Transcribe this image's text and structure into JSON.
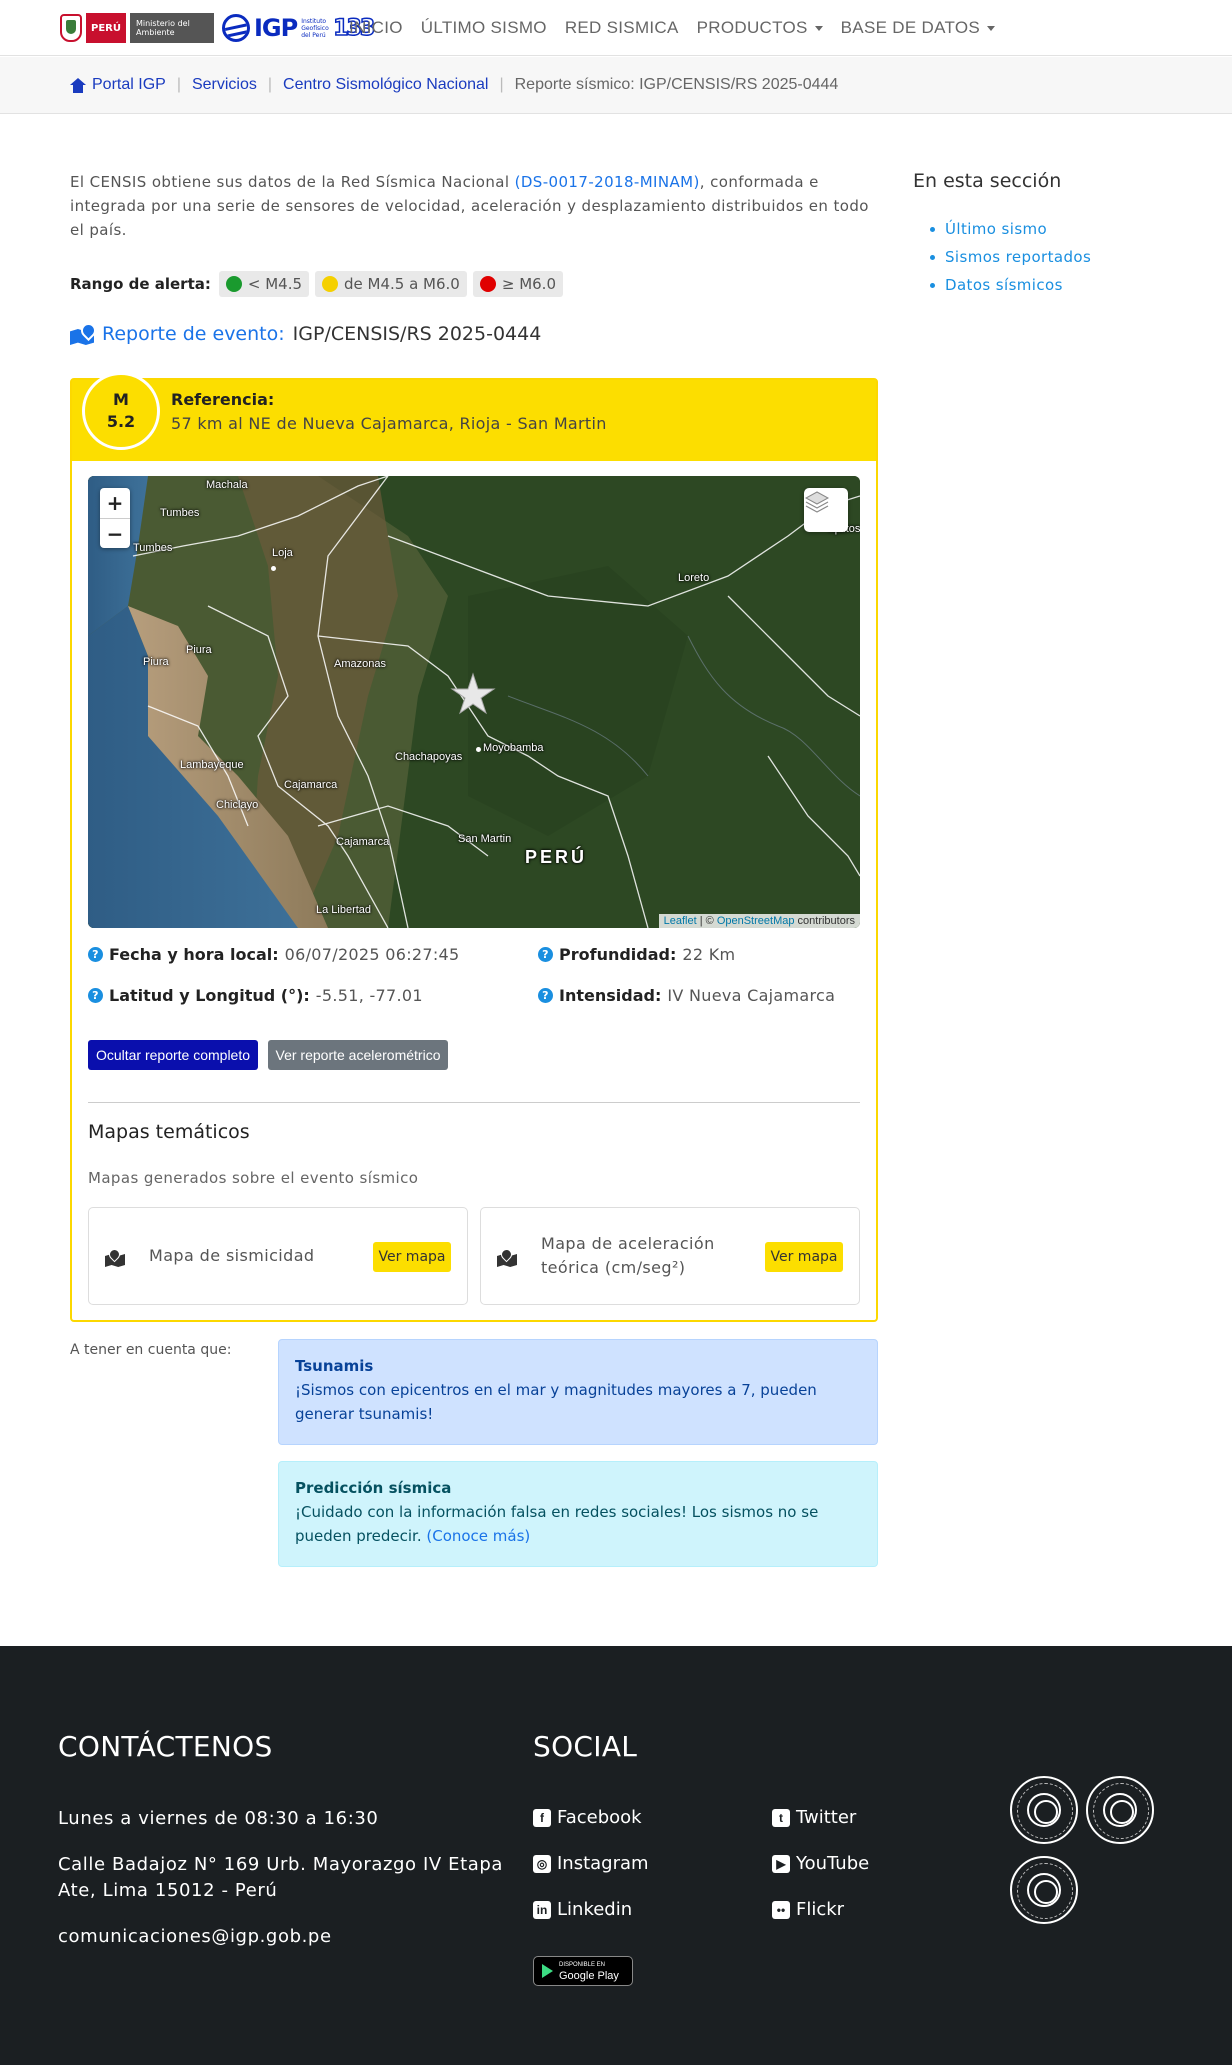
{
  "nav": {
    "logo_peru": "PERÚ",
    "logo_minam": "Ministerio del Ambiente",
    "logo_igp": "IGP",
    "logo_igp_sub": "Instituto Geofísico del Perú",
    "logo_anniv": "133",
    "items": [
      {
        "label": "INICIO",
        "dropdown": false
      },
      {
        "label": "ÚLTIMO SISMO",
        "dropdown": false
      },
      {
        "label": "RED SISMICA",
        "dropdown": false
      },
      {
        "label": "PRODUCTOS",
        "dropdown": true
      },
      {
        "label": "BASE DE DATOS",
        "dropdown": true
      }
    ]
  },
  "breadcrumb": {
    "items": [
      "Portal IGP",
      "Servicios",
      "Centro Sismológico Nacional"
    ],
    "current": "Reporte sísmico: IGP/CENSIS/RS 2025-0444"
  },
  "intro": {
    "text_before": "El CENSIS obtiene sus datos de la Red Sísmica Nacional ",
    "link": "(DS-0017-2018-MINAM)",
    "text_after": ", conformada e integrada por una serie de sensores de velocidad, aceleración y desplazamiento distribuidos en todo el país."
  },
  "alert_range": {
    "label": "Rango de alerta:",
    "levels": [
      {
        "text": "< M4.5",
        "color": "#1a9a2e"
      },
      {
        "text": "de M4.5 a M6.0",
        "color": "#f5d000"
      },
      {
        "text": "≥ M6.0",
        "color": "#e00000"
      }
    ]
  },
  "event": {
    "title_label": "Reporte de evento:",
    "title_value": "IGP/CENSIS/RS 2025-0444",
    "mag_prefix": "M",
    "magnitude": "5.2",
    "ref_label": "Referencia:",
    "ref_value": "57 km al NE de Nueva Cajamarca, Rioja - San Martin",
    "fecha_label": "Fecha y hora local:",
    "fecha_value": "06/07/2025 06:27:45",
    "prof_label": "Profundidad:",
    "prof_value": "22 Km",
    "latlon_label": "Latitud y Longitud (°):",
    "latlon_value": "-5.51, -77.01",
    "int_label": "Intensidad:",
    "int_value": "IV Nueva Cajamarca",
    "btn_hide": "Ocultar reporte completo",
    "btn_accel": "Ver reporte acelerométrico"
  },
  "map": {
    "zoom_in": "+",
    "zoom_out": "−",
    "attrib_leaflet": "Leaflet",
    "attrib_sep": " | © ",
    "attrib_osm": "OpenStreetMap",
    "attrib_tail": " contributors",
    "labels": {
      "machala": "Machala",
      "tumbes1": "Tumbes",
      "tumbes2": "Tumbes",
      "loja": "Loja",
      "loreto": "Loreto",
      "piura1": "Piura",
      "piura2": "Piura",
      "amazonas": "Amazonas",
      "chachapoyas": "Chachapoyas",
      "moyobamba": "Moyobamba",
      "lambayeque": "Lambayeque",
      "cajamarca1": "Cajamarca",
      "chiclayo": "Chiclayo",
      "cajamarca2": "Cajamarca",
      "sanmartin": "San Martin",
      "peru": "PERÚ",
      "lalibertad": "La Libertad",
      "iquitos": "Iquitos"
    }
  },
  "thematic": {
    "title": "Mapas temáticos",
    "subtitle": "Mapas generados sobre el evento sísmico",
    "cards": [
      {
        "label": "Mapa de sismicidad",
        "button": "Ver mapa"
      },
      {
        "label": "Mapa de aceleración teórica (cm/seg²)",
        "button": "Ver mapa"
      }
    ]
  },
  "notes": {
    "label": "A tener en cuenta que:",
    "tsunami_title": "Tsunamis",
    "tsunami_text": "¡Sismos con epicentros en el mar y magnitudes mayores a 7, pueden generar tsunamis!",
    "pred_title": "Predicción sísmica",
    "pred_text": "¡Cuidado con la información falsa en redes sociales! Los sismos no se pueden predecir. ",
    "pred_link": "(Conoce más)"
  },
  "sidebar": {
    "title": "En esta sección",
    "items": [
      "Último sismo",
      "Sismos reportados",
      "Datos sísmicos"
    ]
  },
  "footer": {
    "contact_title": "CONTÁCTENOS",
    "hours": "Lunes a viernes de 08:30 a 16:30",
    "address1": "Calle Badajoz N° 169 Urb. Mayorazgo IV Etapa",
    "address2": "Ate, Lima 15012 - Perú",
    "email": "comunicaciones@igp.gob.pe",
    "social_title": "SOCIAL",
    "social": [
      "Facebook",
      "Twitter",
      "Instagram",
      "YouTube",
      "Linkedin",
      "Flickr"
    ],
    "gplay_small": "DISPONIBLE EN",
    "gplay_big": "Google Play"
  }
}
